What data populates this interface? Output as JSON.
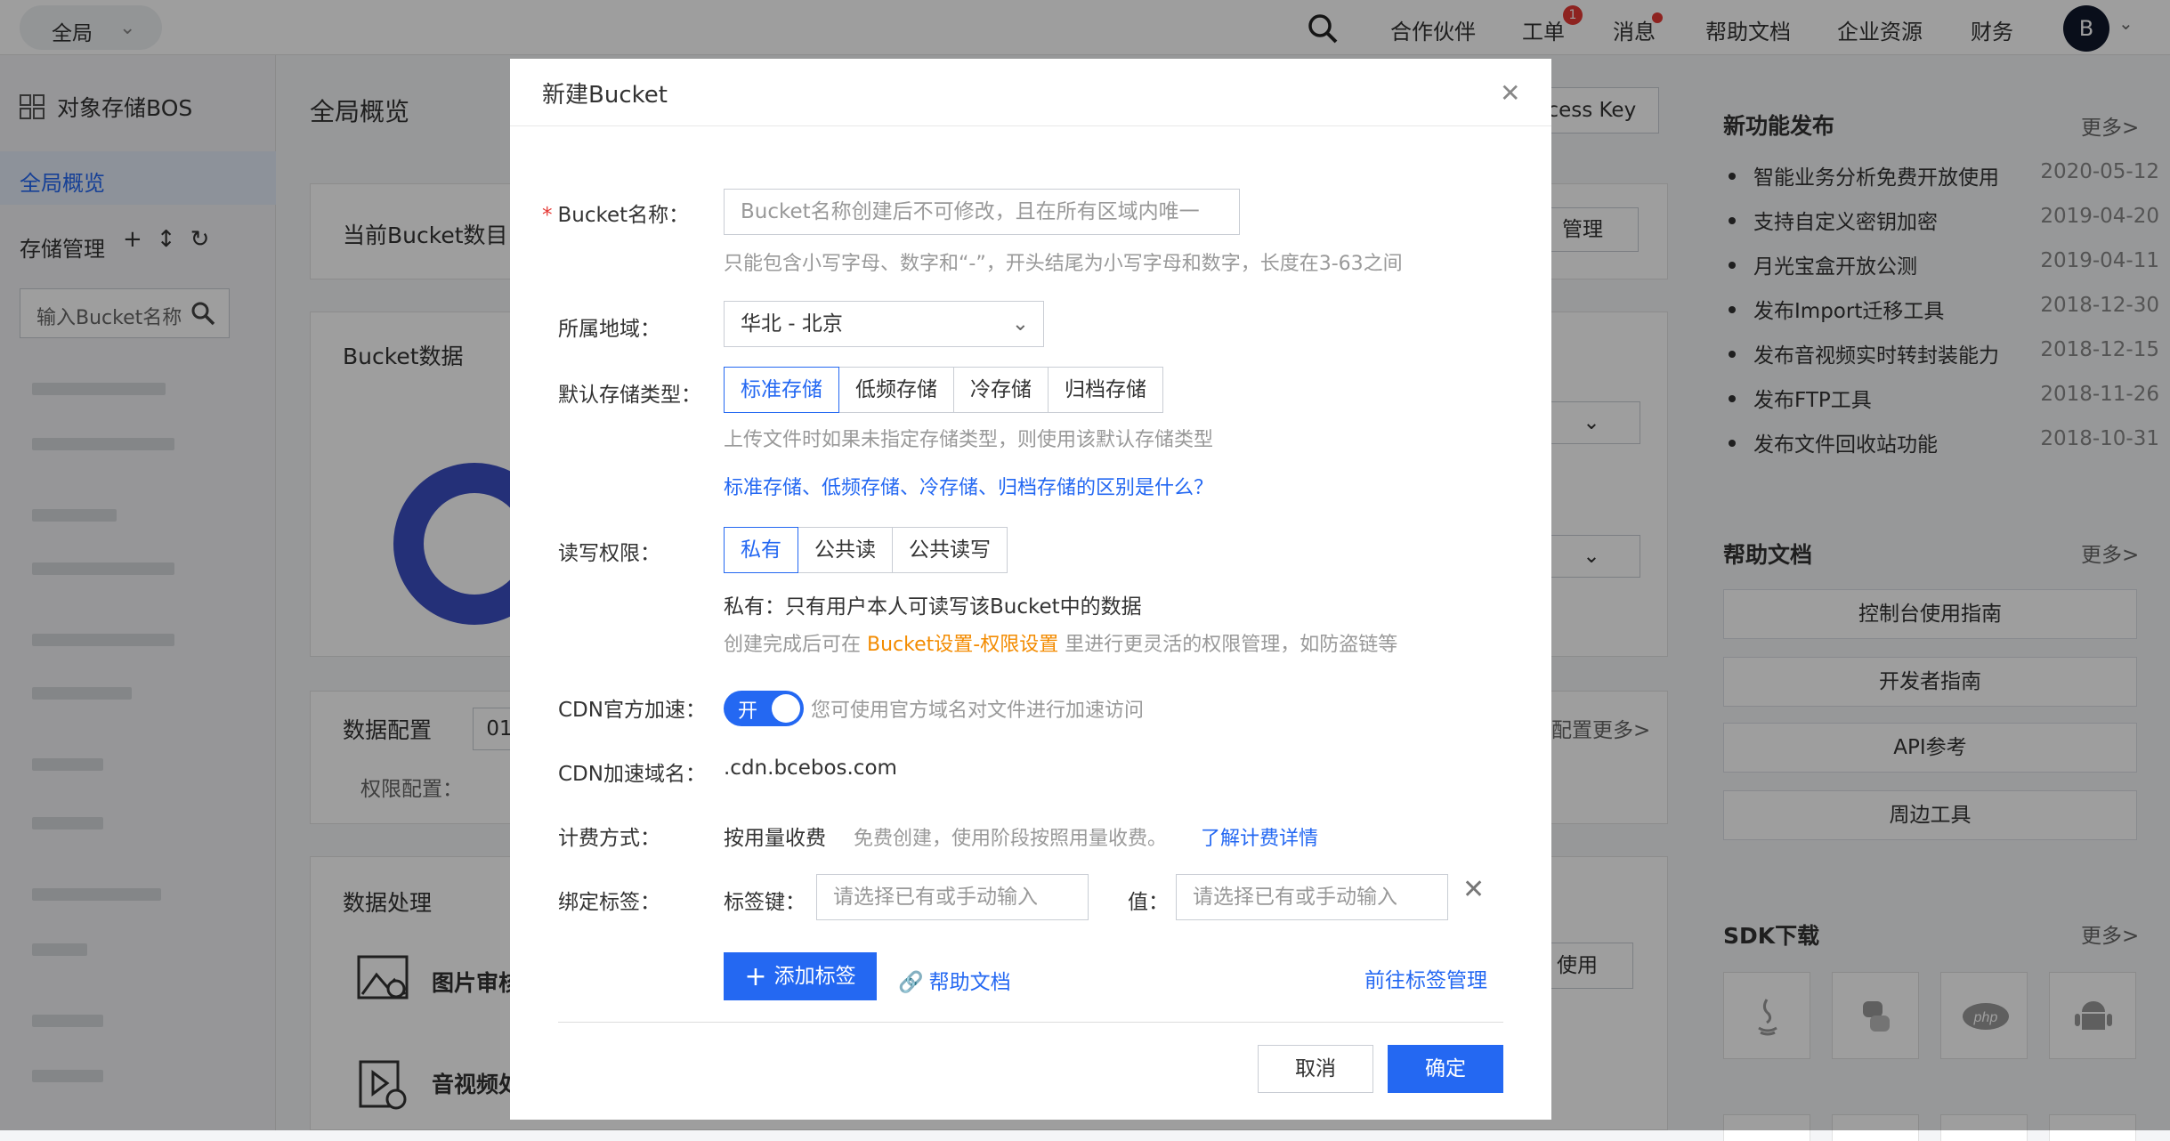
{
  "topbar": {
    "region": "全局",
    "nav": [
      "合作伙伴",
      "工单",
      "消息",
      "帮助文档",
      "企业资源",
      "财务"
    ],
    "ticket_badge": "1",
    "avatar": "B"
  },
  "sidebar": {
    "title": "对象存储BOS",
    "overview": "全局概览",
    "manage": "存储管理",
    "search_placeholder": "输入Bucket名称"
  },
  "main": {
    "title": "全局概览",
    "access_key": "ccess Key",
    "bucket_count_label": "当前Bucket数目：",
    "manage_btn": "管理",
    "bucket_data": "Bucket数据",
    "data_config": "数据配置",
    "config_value": "01",
    "perm_config": "权限配置：",
    "more_config": "配置更多>",
    "data_processing": "数据处理",
    "image_audit": "图片审核",
    "av_processing": "音视频处",
    "use_btn": "使用"
  },
  "right": {
    "new_features_title": "新功能发布",
    "more": "更多>",
    "news": [
      {
        "title": "智能业务分析免费开放使用",
        "date": "2020-05-12"
      },
      {
        "title": "支持自定义密钥加密",
        "date": "2019-04-20"
      },
      {
        "title": "月光宝盒开放公测",
        "date": "2019-04-11"
      },
      {
        "title": "发布Import迁移工具",
        "date": "2018-12-30"
      },
      {
        "title": "发布音视频实时转封装能力",
        "date": "2018-12-15"
      },
      {
        "title": "发布FTP工具",
        "date": "2018-11-26"
      },
      {
        "title": "发布文件回收站功能",
        "date": "2018-10-31"
      }
    ],
    "help_title": "帮助文档",
    "help_links": [
      "控制台使用指南",
      "开发者指南",
      "API参考",
      "周边工具"
    ],
    "sdk_title": "SDK下载",
    "sdk_php": "php"
  },
  "modal": {
    "title": "新建Bucket",
    "name_label": "Bucket名称：",
    "name_placeholder": "Bucket名称创建后不可修改，且在所有区域内唯一",
    "name_hint": "只能包含小写字母、数字和“-”，开头结尾为小写字母和数字，长度在3-63之间",
    "region_label": "所属地域：",
    "region_value": "华北 - 北京",
    "storage_label": "默认存储类型：",
    "storage_options": [
      "标准存储",
      "低频存储",
      "冷存储",
      "归档存储"
    ],
    "storage_hint": "上传文件时如果未指定存储类型，则使用该默认存储类型",
    "storage_link": "标准存储、低频存储、冷存储、归档存储的区别是什么？",
    "perm_label": "读写权限：",
    "perm_options": [
      "私有",
      "公共读",
      "公共读写"
    ],
    "perm_desc": "私有：只有用户本人可读写该Bucket中的数据",
    "perm_hint_pre": "创建完成后可在",
    "perm_hint_link": "Bucket设置-权限设置",
    "perm_hint_post": "里进行更灵活的权限管理，如防盗链等",
    "cdn_label": "CDN官方加速：",
    "cdn_toggle": "开",
    "cdn_hint": "您可使用官方域名对文件进行加速访问",
    "cdn_domain_label": "CDN加速域名：",
    "cdn_domain": ".cdn.bcebos.com",
    "billing_label": "计费方式：",
    "billing_value": "按用量收费",
    "billing_hint": "免费创建，使用阶段按照用量收费。",
    "billing_link": "了解计费详情",
    "tag_label": "绑定标签：",
    "tag_key_label": "标签键：",
    "tag_key_placeholder": "请选择已有或手动输入",
    "tag_value_label": "值：",
    "tag_value_placeholder": "请选择已有或手动输入",
    "add_tag": "添加标签",
    "help_doc": "帮助文档",
    "tag_manage": "前往标签管理",
    "cancel": "取消",
    "confirm": "确定"
  }
}
